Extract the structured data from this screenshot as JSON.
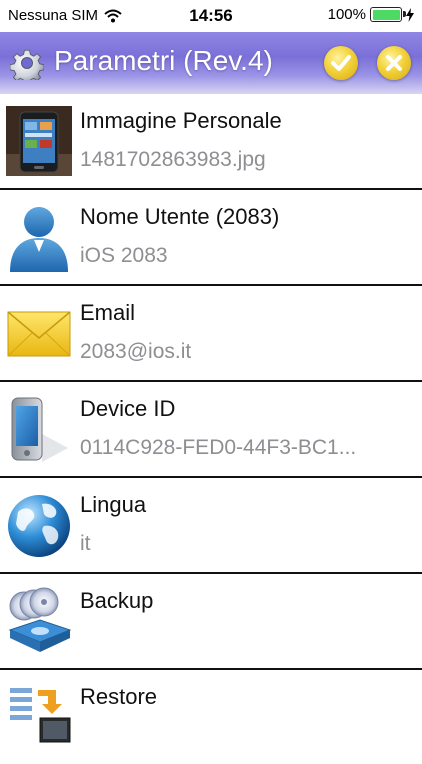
{
  "status_bar": {
    "carrier": "Nessuna SIM",
    "time": "14:56",
    "battery_pct": "100%",
    "battery_color": "#4cd964"
  },
  "header": {
    "title": "Parametri (Rev.4)",
    "left_icon": "gear-icon",
    "confirm_icon": "checkmark-icon",
    "cancel_icon": "close-icon",
    "gradient_color": "#7a70d8",
    "button_color": "#f2d23a"
  },
  "settings": {
    "items": [
      {
        "title": "Immagine Personale",
        "subtitle": "1481702863983.jpg",
        "icon": "profile-photo-icon"
      },
      {
        "title": "Nome Utente (2083)",
        "subtitle": "iOS 2083",
        "icon": "user-icon"
      },
      {
        "title": "Email",
        "subtitle": "2083@ios.it",
        "icon": "envelope-icon"
      },
      {
        "title": "Device ID",
        "subtitle": "0114C928-FED0-44F3-BC1...",
        "icon": "phone-icon"
      },
      {
        "title": "Lingua",
        "subtitle": "it",
        "icon": "globe-icon"
      },
      {
        "title": "Backup",
        "subtitle": "",
        "icon": "backup-icon"
      },
      {
        "title": "Restore",
        "subtitle": "",
        "icon": "restore-icon"
      }
    ]
  }
}
